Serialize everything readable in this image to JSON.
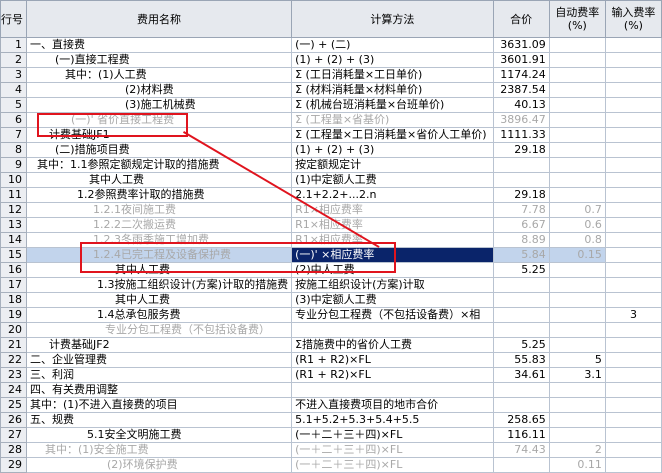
{
  "header": {
    "row_no": "行号",
    "name": "费用名称",
    "calc": "计算方法",
    "total": "合价",
    "auto_rate_line1": "自动费率",
    "auto_rate_line2": "(%)",
    "input_rate_line1": "输入费率",
    "input_rate_line2": "(%)"
  },
  "rows": [
    {
      "no": "1",
      "name": "一、直接费",
      "calc": "(一) + (二)",
      "total": "3631.09",
      "auto": "",
      "input": ""
    },
    {
      "no": "2",
      "name": "(一)直接工程费",
      "calc": "(1) + (2) + (3)",
      "total": "3601.91",
      "auto": "",
      "input": ""
    },
    {
      "no": "3",
      "name": "其中：(1)人工费",
      "calc": "Σ (工日消耗量×工日单价)",
      "total": "1174.24",
      "auto": "",
      "input": ""
    },
    {
      "no": "4",
      "name": "(2)材料费",
      "calc": "Σ (材料消耗量×材料单价)",
      "total": "2387.54",
      "auto": "",
      "input": ""
    },
    {
      "no": "5",
      "name": "(3)施工机械费",
      "calc": "Σ (机械台班消耗量×台班单价)",
      "total": "40.13",
      "auto": "",
      "input": ""
    },
    {
      "no": "6",
      "name": "(一)' 省价直接工程费",
      "calc": "Σ (工程量×省基价)",
      "total": "3896.47",
      "auto": "",
      "input": ""
    },
    {
      "no": "7",
      "name": "计费基础JF1",
      "calc": "Σ (工程量×工日消耗量×省价人工单价)",
      "total": "1111.33",
      "auto": "",
      "input": ""
    },
    {
      "no": "8",
      "name": "(二)措施项目费",
      "calc": "(1) + (2) + (3)",
      "total": "29.18",
      "auto": "",
      "input": ""
    },
    {
      "no": "9",
      "name": "其中：1.1参照定额规定计取的措施费",
      "calc": "按定额规定计",
      "total": "",
      "auto": "",
      "input": ""
    },
    {
      "no": "10",
      "name": "其中人工费",
      "calc": "(1)中定额人工费",
      "total": "",
      "auto": "",
      "input": ""
    },
    {
      "no": "11",
      "name": "1.2参照费率计取的措施费",
      "calc": "2.1+2.2+...2.n",
      "total": "29.18",
      "auto": "",
      "input": ""
    },
    {
      "no": "12",
      "name": "1.2.1夜间施工费",
      "calc": "R1×相应费率",
      "total": "7.78",
      "auto": "0.7",
      "input": ""
    },
    {
      "no": "13",
      "name": "1.2.2二次搬运费",
      "calc": "R1×相应费率",
      "total": "6.67",
      "auto": "0.6",
      "input": ""
    },
    {
      "no": "14",
      "name": "1.2.3冬雨季施工增加费",
      "calc": "R1×相应费率",
      "total": "8.89",
      "auto": "0.8",
      "input": ""
    },
    {
      "no": "15",
      "name": "1.2.4已完工程及设备保护费",
      "calc": "(一)' ×相应费率",
      "total": "5.84",
      "auto": "0.15",
      "input": ""
    },
    {
      "no": "16",
      "name": "其中人工费",
      "calc": "(2)中人工费",
      "total": "5.25",
      "auto": "",
      "input": ""
    },
    {
      "no": "17",
      "name": "1.3按施工组织设计(方案)计取的措施费",
      "calc": "按施工组织设计(方案)计取",
      "total": "",
      "auto": "",
      "input": ""
    },
    {
      "no": "18",
      "name": "其中人工费",
      "calc": "(3)中定额人工费",
      "total": "",
      "auto": "",
      "input": ""
    },
    {
      "no": "19",
      "name": "1.4总承包服务费",
      "calc": "专业分包工程费（不包括设备费）×相",
      "total": "",
      "auto": "",
      "input": "3"
    },
    {
      "no": "20",
      "name": "专业分包工程费（不包括设备费）",
      "calc": "",
      "total": "",
      "auto": "",
      "input": ""
    },
    {
      "no": "21",
      "name": "计费基础JF2",
      "calc": "Σ措施费中的省价人工费",
      "total": "5.25",
      "auto": "",
      "input": ""
    },
    {
      "no": "22",
      "name": "二、企业管理费",
      "calc": "(R1 + R2)×FL",
      "total": "55.83",
      "auto": "5",
      "input": ""
    },
    {
      "no": "23",
      "name": "三、利润",
      "calc": "(R1 + R2)×FL",
      "total": "34.61",
      "auto": "3.1",
      "input": ""
    },
    {
      "no": "24",
      "name": "四、有关费用调整",
      "calc": "",
      "total": "",
      "auto": "",
      "input": ""
    },
    {
      "no": "25",
      "name": "其中：(1)不进入直接费的项目",
      "calc": "不进入直接费项目的地市合价",
      "total": "",
      "auto": "",
      "input": ""
    },
    {
      "no": "26",
      "name": "五、规费",
      "calc": "5.1+5.2+5.3+5.4+5.5",
      "total": "258.65",
      "auto": "",
      "input": ""
    },
    {
      "no": "27",
      "name": "5.1安全文明施工费",
      "calc": "(一＋二＋三＋四)×FL",
      "total": "116.11",
      "auto": "",
      "input": ""
    },
    {
      "no": "28",
      "name": "其中：(1)安全施工费",
      "calc": "(一＋二＋三＋四)×FL",
      "total": "74.43",
      "auto": "2",
      "input": ""
    },
    {
      "no": "29",
      "name": "(2)环境保护费",
      "calc": "(一＋二＋三＋四)×FL",
      "total": "",
      "auto": "0.11",
      "input": ""
    }
  ]
}
